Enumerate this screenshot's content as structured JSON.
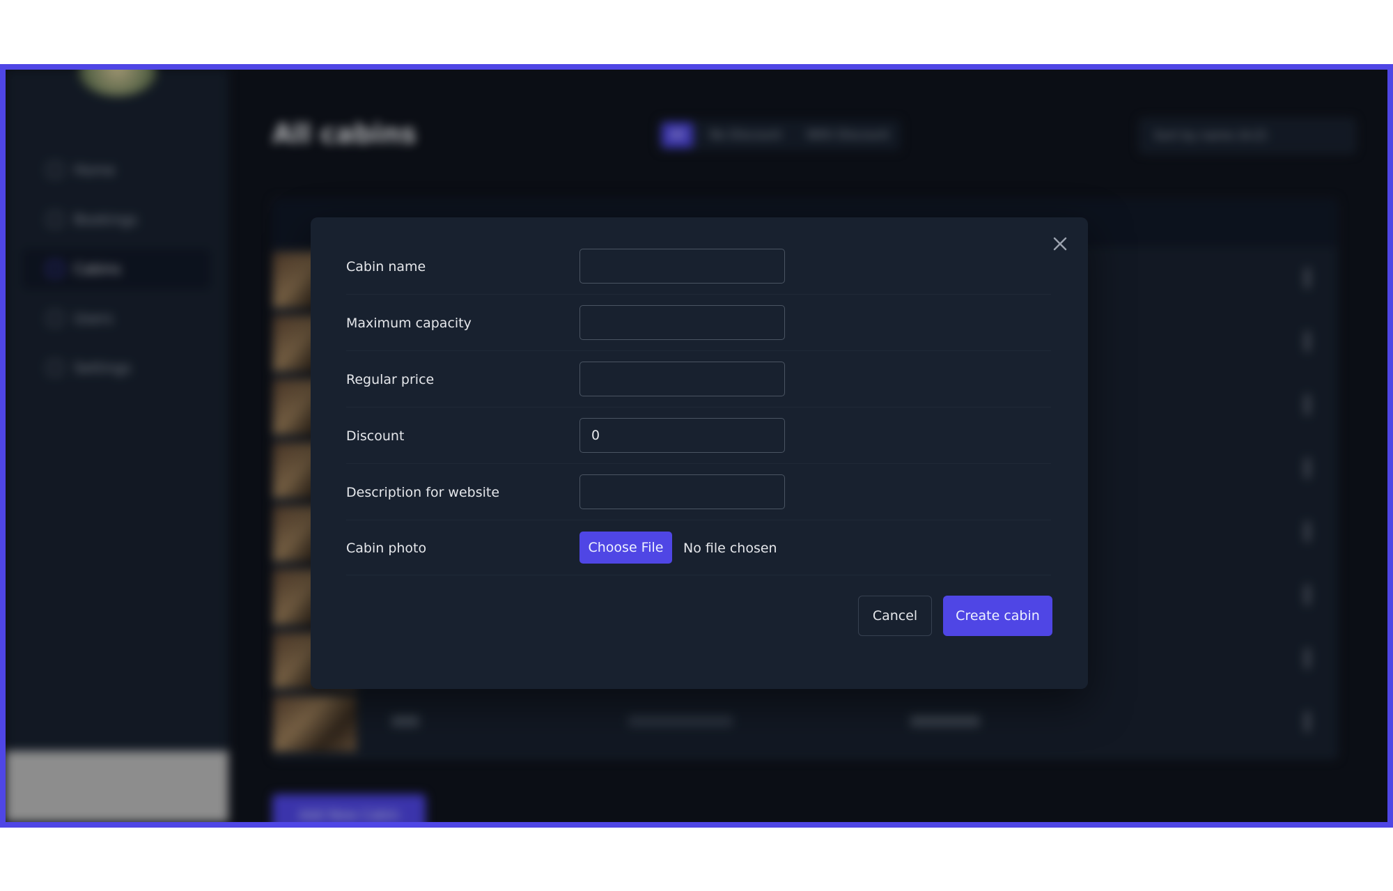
{
  "background": {
    "title": "All cabins",
    "filters": [
      "All",
      "No Discount",
      "With Discount"
    ],
    "sort_label": "Sort by name (A-Z)",
    "sidebar": [
      "Home",
      "Bookings",
      "Cabins",
      "Users",
      "Settings"
    ],
    "add_button": "Add New Cabin"
  },
  "modal": {
    "fields": {
      "name": {
        "label": "Cabin name",
        "value": ""
      },
      "capacity": {
        "label": "Maximum capacity",
        "value": ""
      },
      "price": {
        "label": "Regular price",
        "value": ""
      },
      "discount": {
        "label": "Discount",
        "value": "0"
      },
      "description": {
        "label": "Description for website",
        "value": ""
      },
      "photo": {
        "label": "Cabin photo",
        "button": "Choose File",
        "status": "No file chosen"
      }
    },
    "cancel_label": "Cancel",
    "submit_label": "Create cabin"
  },
  "colors": {
    "accent": "#4f46e5",
    "modal_bg": "#18212f",
    "page_bg": "#0f131c"
  },
  "icons": {
    "close": "close-icon"
  }
}
